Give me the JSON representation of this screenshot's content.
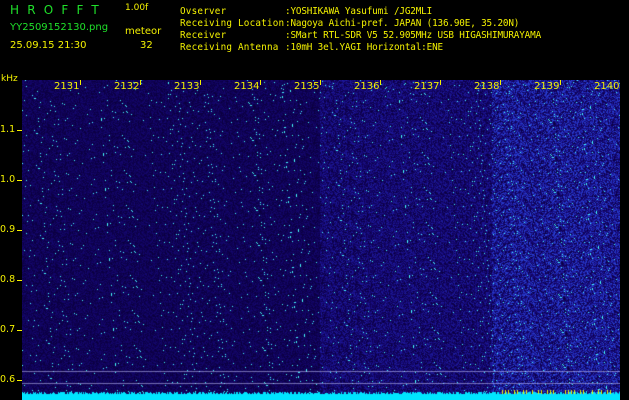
{
  "header": {
    "logo_text": "HROFFT",
    "version": "1.00f",
    "file_name": "YY2509152130.png",
    "mode_label": "meteor",
    "datetime": "25.09.15 21:30",
    "count": "32"
  },
  "info": [
    {
      "label": "Ovserver",
      "value": ":YOSHIKAWA Yasufumi /JG2MLI"
    },
    {
      "label": "Receiving Location",
      "value": ":Nagoya Aichi-pref. JAPAN (136.90E, 35.20N)"
    },
    {
      "label": "Receiver",
      "value": ":SMart RTL-SDR V5 52.905MHz USB HIGASHIMURAYAMA"
    },
    {
      "label": "Receiving Antenna",
      "value": ":10mH 3el.YAGI Horizontal:ENE"
    }
  ],
  "y_axis": {
    "unit": "kHz",
    "ticks": [
      "1.1",
      "1.0",
      "0.9",
      "0.8",
      "0.7",
      "0.6"
    ]
  },
  "x_axis": {
    "ticks": [
      "2131",
      "2132",
      "2133",
      "2134",
      "2135",
      "2136",
      "2137",
      "2138",
      "2139",
      "2140"
    ]
  },
  "colors": {
    "text_green": "#1fe02a",
    "text_yellow": "#f4f200",
    "spectrum_bg": "#12168a",
    "signal_cyan": "#00e5ff"
  }
}
